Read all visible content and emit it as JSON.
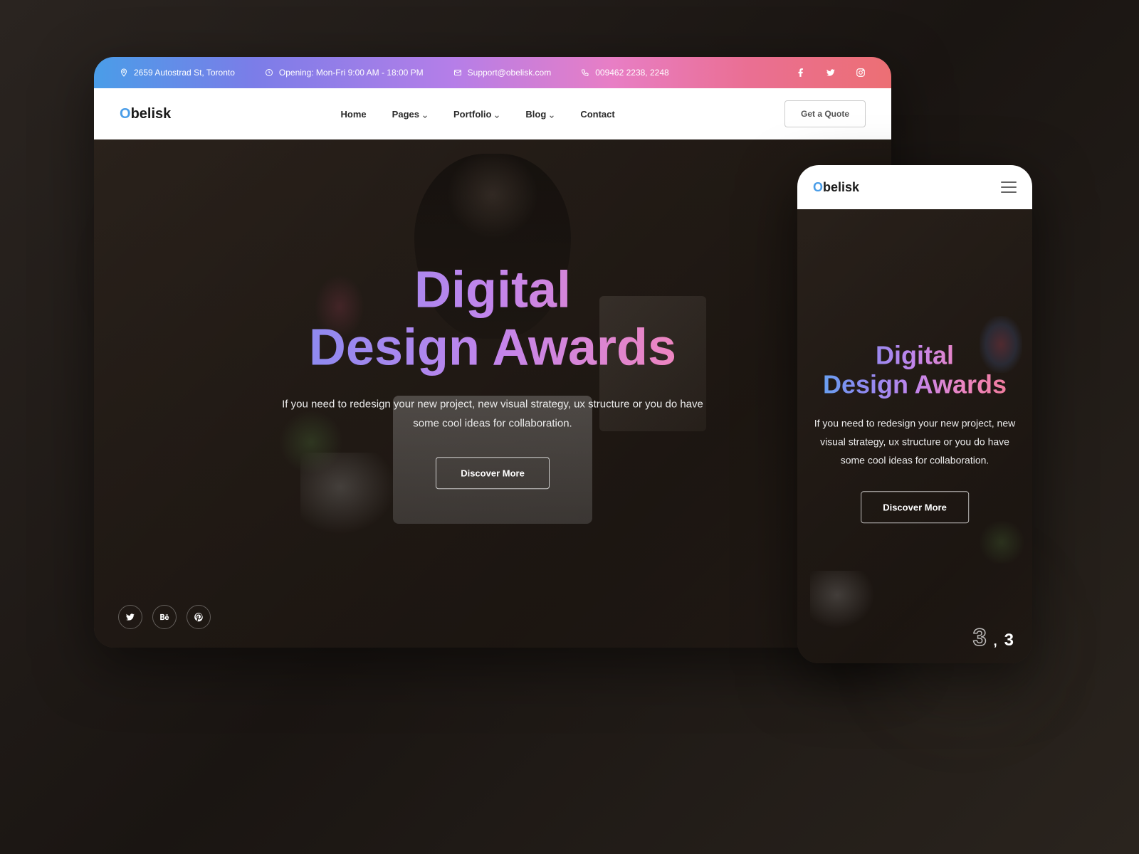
{
  "logo": {
    "first_letter": "O",
    "rest": "belisk"
  },
  "topbar": {
    "address": "2659 Autostrad St, Toronto",
    "hours": "Opening: Mon-Fri 9:00 AM - 18:00 PM",
    "email": "Support@obelisk.com",
    "phone": "009462 2238, 2248"
  },
  "nav": {
    "items": [
      {
        "label": "Home",
        "has_dropdown": false
      },
      {
        "label": "Pages",
        "has_dropdown": true
      },
      {
        "label": "Portfolio",
        "has_dropdown": true
      },
      {
        "label": "Blog",
        "has_dropdown": true
      },
      {
        "label": "Contact",
        "has_dropdown": false
      }
    ],
    "cta": "Get a Quote"
  },
  "hero": {
    "title_line1": "Digital",
    "title_line2": "Design Awards",
    "subtitle": "If you need to redesign your new project, new visual strategy, ux structure or you do have some cool ideas for collaboration.",
    "cta": "Discover More"
  },
  "mobile": {
    "slide_current": "3",
    "slide_separator": ",",
    "slide_total": "3"
  }
}
